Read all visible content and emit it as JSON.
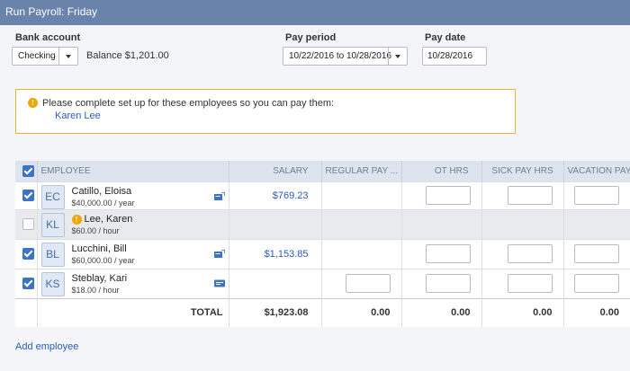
{
  "window": {
    "title": "Run Payroll: Friday"
  },
  "bank_account": {
    "label": "Bank account",
    "selected": "Checking",
    "balance": "Balance $1,201.00"
  },
  "pay_period": {
    "label": "Pay period",
    "selected": "10/22/2016 to 10/28/2016"
  },
  "pay_date": {
    "label": "Pay date",
    "value": "10/28/2016"
  },
  "alert": {
    "icon": "warning-icon",
    "message": "Please complete set up for these employees so you can pay them:",
    "employee_link": "Karen Lee"
  },
  "table": {
    "columns": [
      "EMPLOYEE",
      "SALARY",
      "REGULAR PAY ...",
      "OT HRS",
      "SICK PAY HRS",
      "VACATION PAY ..."
    ],
    "rows": [
      {
        "checked": true,
        "initials": "EC",
        "name": "Catillo, Eloisa",
        "rate": "$40,000.00 / year",
        "salary": "$769.23",
        "warning": false,
        "method_icon": "direct-deposit-icon"
      },
      {
        "checked": false,
        "initials": "KL",
        "name": "Lee, Karen",
        "rate": "$60.00 / hour",
        "salary": "",
        "warning": true,
        "method_icon": ""
      },
      {
        "checked": true,
        "initials": "BL",
        "name": "Lucchini, Bill",
        "rate": "$60,000.00 / year",
        "salary": "$1,153.85",
        "warning": false,
        "method_icon": "direct-deposit-icon"
      },
      {
        "checked": true,
        "initials": "KS",
        "name": "Steblay, Kari",
        "rate": "$18.00 / hour",
        "salary": "",
        "warning": false,
        "method_icon": "paper-check-icon"
      }
    ],
    "total": {
      "label": "TOTAL",
      "salary": "$1,923.08",
      "regular": "0.00",
      "ot": "0.00",
      "sick": "0.00",
      "vacation": "0.00"
    }
  },
  "footer": {
    "add_employee": "Add employee"
  },
  "colors": {
    "header_bar": "#6983aa",
    "link": "#2a5bb8",
    "checkbox": "#3d73c4",
    "warning": "#f0a500"
  }
}
